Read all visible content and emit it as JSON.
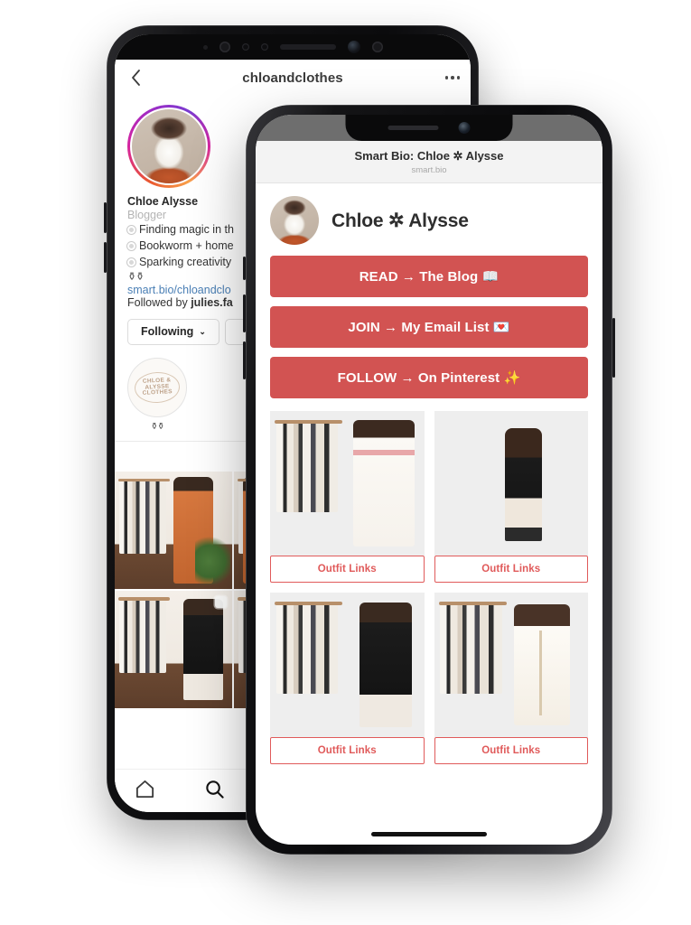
{
  "instagram": {
    "nav": {
      "back_icon": "chevron-left-icon",
      "title": "chloandclothes",
      "more_icon": "more-options-icon"
    },
    "profile": {
      "avatar_alt": "profile-photo",
      "name": "Chloe Alysse",
      "category": "Blogger",
      "bio_lines": [
        "Finding magic in th",
        "Bookworm + home",
        "Sparking creativity"
      ],
      "emoji_line": "⚱⚱",
      "link": "smart.bio/chloandclo",
      "followed_by_prefix": "Followed by ",
      "followed_by_name": "julies.fa"
    },
    "actions": {
      "following_label": "Following",
      "chevron": "⌄"
    },
    "highlight": {
      "logo_text": "CHLOE & ALYSSE CLOTHES",
      "label": "⚱⚱"
    },
    "tabs": {
      "grid_icon": "grid-view-icon"
    },
    "bottom_bar": {
      "home_icon": "home-icon",
      "search_icon": "search-icon"
    },
    "posts": [
      {
        "name": "post-orange-dress"
      },
      {
        "name": "post-black-dress"
      },
      {
        "name": "post-rack"
      },
      {
        "name": "post-cream-dress"
      }
    ]
  },
  "smartbio": {
    "header": {
      "title": "Smart Bio: Chloe ✲ Alysse",
      "url": "smart.bio"
    },
    "profile": {
      "avatar_alt": "smart-bio-avatar",
      "name": "Chloe ✲ Alysse"
    },
    "cta_color": "#d25352",
    "cta_buttons": [
      {
        "label": "READ → The Blog 📖"
      },
      {
        "label": "JOIN → My Email List 💌"
      },
      {
        "label": "FOLLOW → On Pinterest ✨"
      }
    ],
    "card_link_color": "#e05a5a",
    "cards": [
      {
        "label": "Outfit Links",
        "image": "white-jumpsuit-rack"
      },
      {
        "label": "Outfit Links",
        "image": "black-dress-mural"
      },
      {
        "label": "Outfit Links",
        "image": "black-pinafore-rack"
      },
      {
        "label": "Outfit Links",
        "image": "cream-dress-rack"
      }
    ]
  }
}
